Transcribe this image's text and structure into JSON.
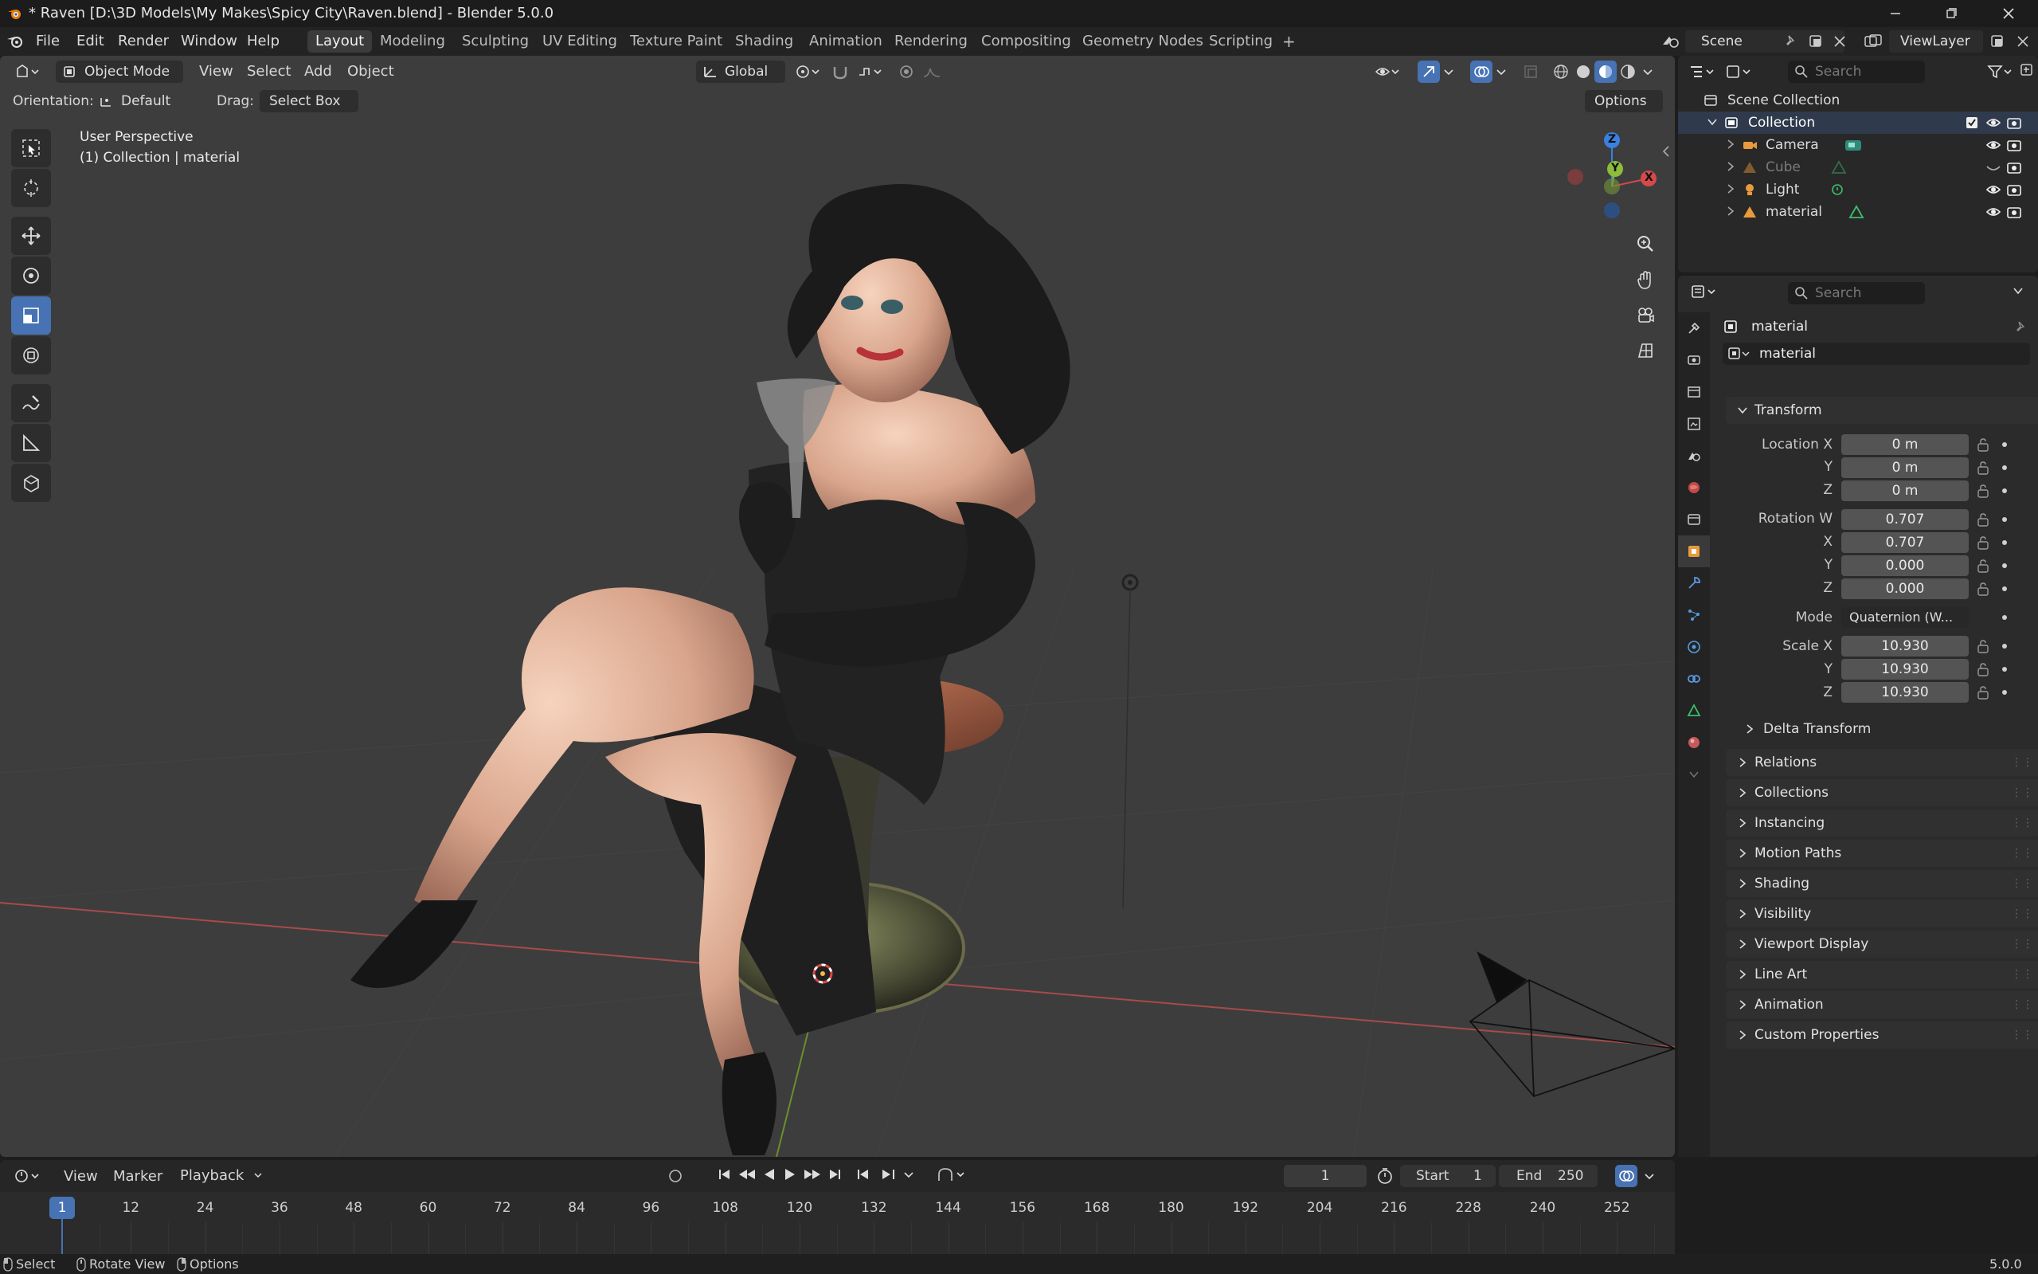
{
  "window": {
    "title": "* Raven [D:\\3D Models\\My Makes\\Spicy City\\Raven.blend] - Blender 5.0.0",
    "controls": [
      "minimize",
      "maximize",
      "close"
    ]
  },
  "menubar": {
    "menus": [
      "File",
      "Edit",
      "Render",
      "Window",
      "Help"
    ],
    "workspaces": [
      "Layout",
      "Modeling",
      "Sculpting",
      "UV Editing",
      "Texture Paint",
      "Shading",
      "Animation",
      "Rendering",
      "Compositing",
      "Geometry Nodes",
      "Scripting"
    ],
    "active_workspace": "Layout",
    "add_workspace": "+",
    "scene": "Scene",
    "view_layer": "ViewLayer"
  },
  "viewport": {
    "mode": "Object Mode",
    "header_menus": [
      "View",
      "Select",
      "Add",
      "Object"
    ],
    "transform_orientation": "Global",
    "orientation_label": "Orientation:",
    "orientation_value": "Default",
    "drag_label": "Drag:",
    "drag_value": "Select Box",
    "options_label": "Options",
    "perspective_text": "User Perspective",
    "collection_text": "(1) Collection | material",
    "gizmo": {
      "x": "X",
      "y": "Y",
      "z": "Z"
    }
  },
  "outliner": {
    "search_placeholder": "Search",
    "root": "Scene Collection",
    "collection": "Collection",
    "items": [
      {
        "name": "Camera",
        "icon": "camera-icon",
        "visible": true
      },
      {
        "name": "Cube",
        "icon": "mesh-icon",
        "visible": false
      },
      {
        "name": "Light",
        "icon": "light-icon",
        "visible": true
      },
      {
        "name": "material",
        "icon": "mesh-icon",
        "visible": true
      }
    ]
  },
  "properties": {
    "search_placeholder": "Search",
    "object_name": "material",
    "data_name": "material",
    "transform": {
      "header": "Transform",
      "location_label": "Location X",
      "location": [
        "0 m",
        "0 m",
        "0 m"
      ],
      "rotation_label": "Rotation W",
      "rotation": [
        "0.707",
        "0.707",
        "0.000",
        "0.000"
      ],
      "axis_labels": [
        "X",
        "Y",
        "Z"
      ],
      "mode_label": "Mode",
      "mode_value": "Quaternion (W...",
      "scale_label": "Scale X",
      "scale": [
        "10.930",
        "10.930",
        "10.930"
      ],
      "delta": "Delta Transform"
    },
    "panels": [
      "Relations",
      "Collections",
      "Instancing",
      "Motion Paths",
      "Shading",
      "Visibility",
      "Viewport Display",
      "Line Art",
      "Animation",
      "Custom Properties"
    ]
  },
  "timeline": {
    "menus": [
      "View",
      "Marker",
      "Playback"
    ],
    "current_frame": "1",
    "start_label": "Start",
    "start": "1",
    "end_label": "End",
    "end": "250",
    "ticks": [
      "1",
      "12",
      "24",
      "36",
      "48",
      "60",
      "72",
      "84",
      "96",
      "108",
      "120",
      "132",
      "144",
      "156",
      "168",
      "180",
      "192",
      "204",
      "216",
      "228",
      "240",
      "252"
    ]
  },
  "statusbar": {
    "items": [
      "Select",
      "Rotate View",
      "Options"
    ],
    "version": "5.0.0"
  },
  "colors": {
    "accent": "#4772b3",
    "viewport_bg": "#3d3d3d",
    "axis_x": "#d24a4a",
    "axis_y": "#8dbb3c",
    "axis_z": "#3a80e0"
  }
}
